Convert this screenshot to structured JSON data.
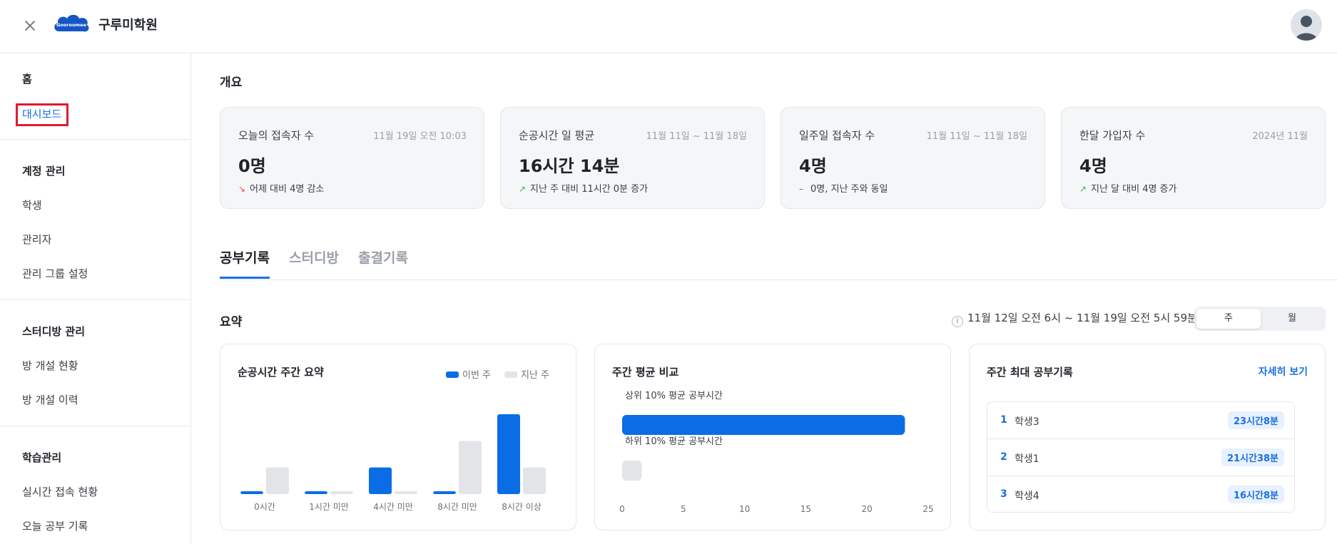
{
  "header": {
    "app_title": "구루미학원",
    "logo_text": "Gooroomee"
  },
  "sidebar": {
    "home": "홈",
    "dashboard": "대시보드",
    "sections": [
      {
        "title": "계정 관리",
        "items": [
          "학생",
          "관리자",
          "관리 그룹 설정"
        ]
      },
      {
        "title": "스터디방 관리",
        "items": [
          "방 개설 현황",
          "방 개설 이력"
        ]
      },
      {
        "title": "학습관리",
        "items": [
          "실시간 접속 현황",
          "오늘 공부 기록"
        ]
      }
    ]
  },
  "overview": {
    "title": "개요",
    "cards": [
      {
        "label": "오늘의 접속자 수",
        "date": "11월 19일 오전 10:03",
        "value": "0명",
        "trend": "down",
        "change": "어제 대비 4명 감소"
      },
      {
        "label": "순공시간 일 평균",
        "date": "11월 11일 ~ 11월 18일",
        "value": "16시간 14분",
        "trend": "up",
        "change": "지난 주 대비 11시간 0분 증가"
      },
      {
        "label": "일주일 접속자 수",
        "date": "11월 11일 ~ 11월 18일",
        "value": "4명",
        "trend": "flat",
        "change": "0명, 지난 주와 동일"
      },
      {
        "label": "한달 가입자 수",
        "date": "2024년 11월",
        "value": "4명",
        "trend": "up",
        "change": "지난 달 대비 4명 증가"
      }
    ]
  },
  "tabs": [
    "공부기록",
    "스터디방",
    "출결기록"
  ],
  "summary": {
    "title": "요약",
    "range": "11월 12일 오전 6시 ~ 11월 19일 오전 5시 59분",
    "period_options": [
      "주",
      "월"
    ],
    "selected_period": "주"
  },
  "colors": {
    "accent": "#1a6fe0",
    "this_week": "#0a6de6",
    "last_week": "#e2e4e8",
    "down": "#e5484d",
    "up": "#2fb34a"
  },
  "weekly_panel": {
    "title": "순공시간 주간 요약",
    "legend_this": "이번 주",
    "legend_last": "지난 주"
  },
  "avg_panel": {
    "title": "주간 평균 비교",
    "top_label": "상위 10% 평균 공부시간",
    "bottom_label": "하위 10% 평균 공부시간"
  },
  "max_panel": {
    "title": "주간 최대 공부기록",
    "detail_link": "자세히 보기",
    "ranks": [
      {
        "rank": "1",
        "name": "학생3",
        "time": "23시간8분"
      },
      {
        "rank": "2",
        "name": "학생1",
        "time": "21시간38분"
      },
      {
        "rank": "3",
        "name": "학생4",
        "time": "16시간8분"
      }
    ]
  },
  "chart_data": [
    {
      "type": "bar",
      "title": "순공시간 주간 요약",
      "categories": [
        "0시간",
        "1시간 미만",
        "4시간 미만",
        "8시간 미만",
        "8시간 이상"
      ],
      "series": [
        {
          "name": "이번 주",
          "values": [
            0.1,
            0.1,
            1,
            0.1,
            3
          ]
        },
        {
          "name": "지난 주",
          "values": [
            1,
            0.1,
            0.1,
            2,
            1
          ]
        }
      ],
      "ylim": [
        0,
        3
      ],
      "grid": false,
      "legend": "top-right"
    },
    {
      "type": "bar",
      "orientation": "horizontal",
      "title": "주간 평균 비교",
      "categories": [
        "상위 10% 평균 공부시간",
        "하위 10% 평균 공부시간"
      ],
      "values": [
        23.1,
        1.6
      ],
      "x_ticks": [
        "0",
        "5",
        "10",
        "15",
        "20",
        "25"
      ],
      "xlim": [
        0,
        25
      ],
      "grid": false
    }
  ]
}
